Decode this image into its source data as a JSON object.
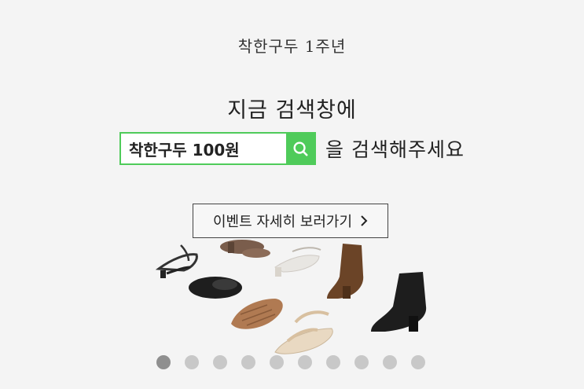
{
  "banner": {
    "top_title": "착한구두 1주년",
    "headline": "지금 검색창에",
    "search": {
      "query": "착한구두 100원",
      "icon": "search-icon",
      "accent_color": "#4fcb5a"
    },
    "suffix_text": "을 검색해주세요",
    "event_button_label": "이벤트 자세히 보러가기",
    "event_button_icon": "chevron-right-icon"
  },
  "carousel": {
    "total_slides": 10,
    "active_index": 0
  }
}
